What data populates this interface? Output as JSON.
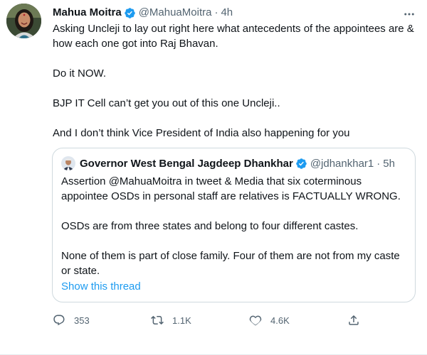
{
  "tweet": {
    "author": {
      "name": "Mahua Moitra",
      "handle": "@MahuaMoitra",
      "time": "4h",
      "separator": "·"
    },
    "paragraphs": [
      "Asking Uncleji to lay out right here what antecedents of the appointees are & how each one got into Raj Bhavan.",
      "Do it NOW.",
      "BJP IT Cell can’t get you out of this one Uncleji..",
      "And I don’t think Vice President of India also happening for you"
    ],
    "quoted": {
      "author": {
        "name": "Governor West Bengal Jagdeep Dhankhar",
        "handle": "@jdhankhar1",
        "time": "5h",
        "separator": "·"
      },
      "paragraphs": [
        "Assertion @MahuaMoitra in tweet & Media that six coterminous appointee OSDs in personal staff are relatives is FACTUALLY WRONG.",
        "OSDs are from three states and belong to four different castes.",
        "None of them is part of close family. Four of them are not from my caste or state."
      ],
      "show_thread_label": "Show this thread"
    },
    "actions": {
      "replies": "353",
      "retweets": "1.1K",
      "likes": "4.6K"
    }
  },
  "colors": {
    "accent": "#1d9bf0",
    "secondary_text": "#536471",
    "border": "#cfd9de"
  },
  "icons": {
    "verified": "verified-badge-icon",
    "more": "more-icon",
    "reply": "reply-icon",
    "retweet": "retweet-icon",
    "like": "heart-icon",
    "share": "share-icon"
  }
}
